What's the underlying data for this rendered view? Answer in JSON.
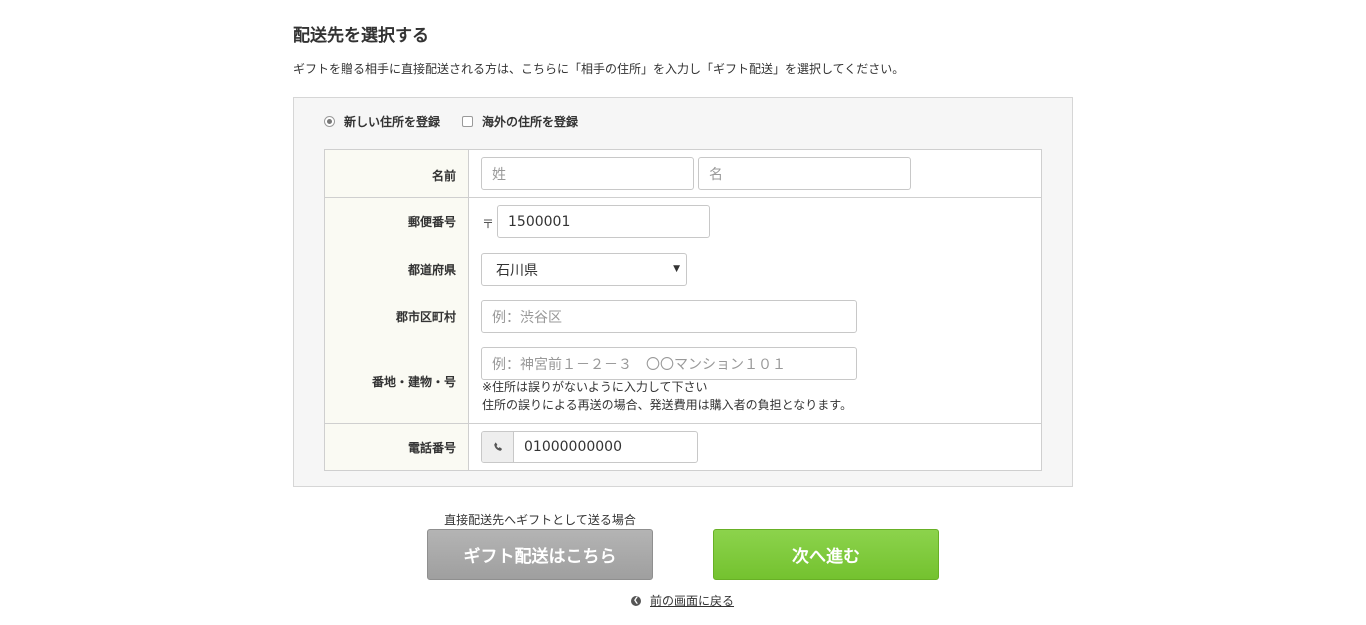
{
  "header": {
    "title": "配送先を選択する",
    "description": "ギフトを贈る相手に直接配送される方は、こちらに「相手の住所」を入力し「ギフト配送」を選択してください。"
  },
  "options": {
    "new_address": "新しい住所を登録",
    "overseas_address": "海外の住所を登録"
  },
  "form": {
    "name_label": "名前",
    "last_name_placeholder": "姓",
    "first_name_placeholder": "名",
    "postal_label": "郵便番号",
    "postal_mark": "〒",
    "postal_value": "1500001",
    "prefecture_label": "都道府県",
    "prefecture_value": "石川県",
    "city_label": "郡市区町村",
    "city_placeholder": "例：渋谷区",
    "street_label": "番地・建物・号",
    "street_placeholder": "例：神宮前１－２－３　〇〇マンション１０１",
    "note_line1": "※住所は誤りがないように入力して下さい",
    "note_line2": "住所の誤りによる再送の場合、発送費用は購入者の負担となります。",
    "phone_label": "電話番号",
    "phone_value": "01000000000"
  },
  "actions": {
    "gift_caption": "直接配送先へギフトとして送る場合",
    "gift_button": "ギフト配送はこちら",
    "next_button": "次へ進む",
    "back_link": "前の画面に戻る"
  },
  "icons": {
    "phone": "phone-icon",
    "back": "chevron-left-circle-icon",
    "dropdown": "triangle-down-icon"
  },
  "colors": {
    "next_button": "#7cc93a",
    "gift_button": "#a9a9a9",
    "label_bg": "#fafaf3",
    "panel_bg": "#f6f6f6"
  }
}
